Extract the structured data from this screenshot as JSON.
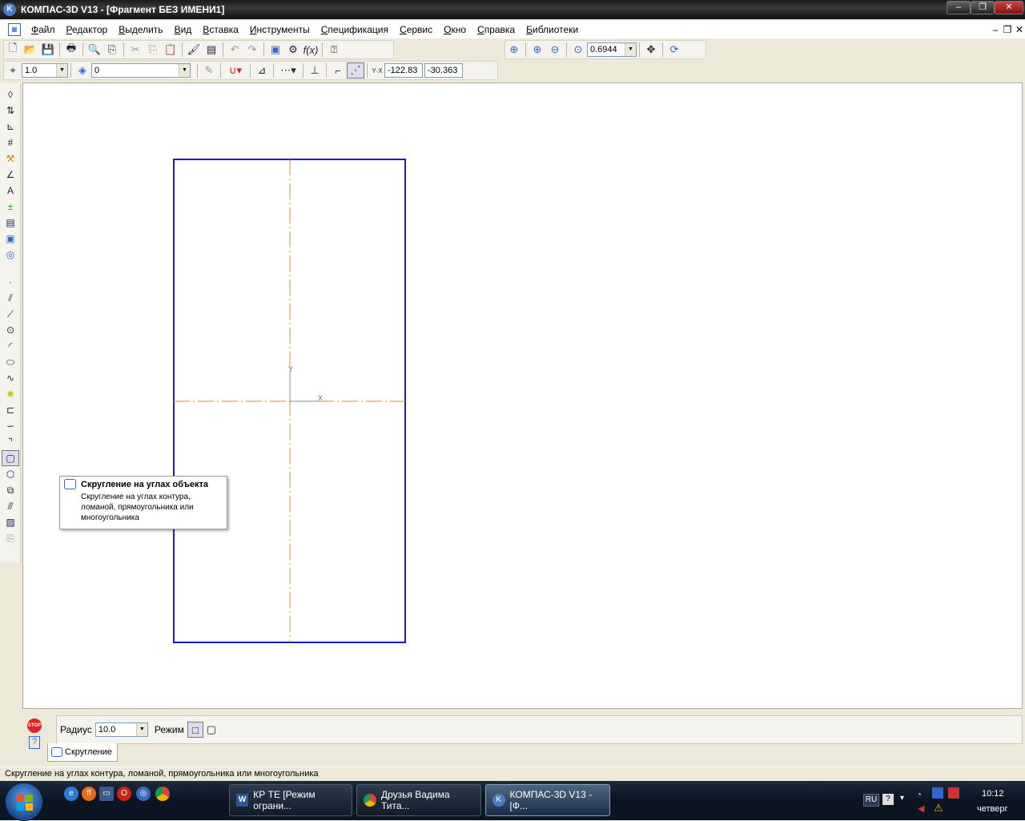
{
  "window": {
    "title": "КОМПАС-3D V13 - [Фрагмент БЕЗ ИМЕНИ1]",
    "app_icon": "K"
  },
  "menu": [
    "Файл",
    "Редактор",
    "Выделить",
    "Вид",
    "Вставка",
    "Инструменты",
    "Спецификация",
    "Сервис",
    "Окно",
    "Справка",
    "Библиотеки"
  ],
  "view_toolbar": {
    "zoom_value": "0.6944"
  },
  "current_toolbar": {
    "step_value": "1.0",
    "layer_value": "0",
    "coord_x": "-122.83",
    "coord_y": "-30.363",
    "coord_label": "Y·X"
  },
  "drawing": {
    "axis_x_label": "X",
    "axis_y_label": "Y"
  },
  "tooltip": {
    "title": "Скругление на углах объекта",
    "body": "Скругление на углах контура, ломаной, прямоугольника или многоугольника"
  },
  "property_panel": {
    "radius_label": "Радиус",
    "radius_value": "10.0",
    "mode_label": "Режим",
    "stop_label": "STOP",
    "help_label": "?",
    "tab_label": "Скругление"
  },
  "status_bar": {
    "text": "Скругление на углах контура, ломаной, прямоугольника или многоугольника"
  },
  "taskbar": {
    "tasks": [
      {
        "label": "КР ТЕ [Режим ограни...",
        "icon": "W"
      },
      {
        "label": "Друзья Вадима Тита...",
        "icon": "chrome"
      },
      {
        "label": "КОМПАС-3D V13 - [Ф...",
        "icon": "K"
      }
    ],
    "lang": "RU",
    "time": "10:12",
    "day": "четверг"
  },
  "colors": {
    "shape_stroke": "#1a1acc",
    "axis_stroke": "#e08a2a"
  }
}
